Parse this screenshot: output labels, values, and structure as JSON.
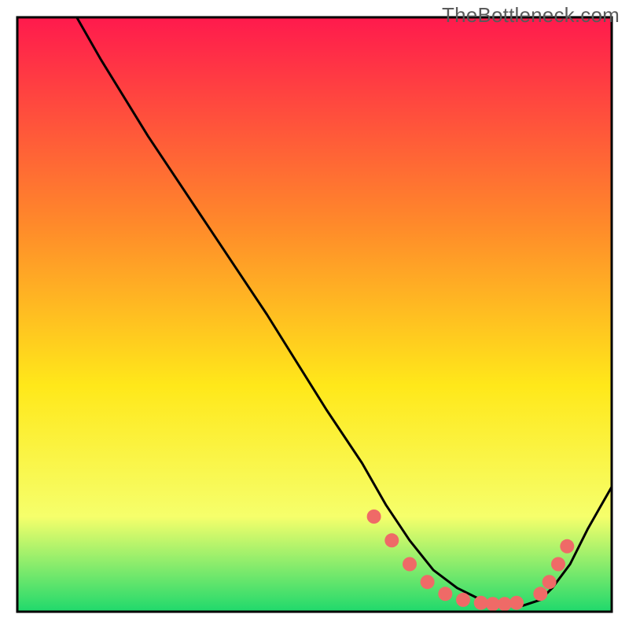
{
  "watermark": "TheBottleneck.com",
  "colors": {
    "gradient_top": "#ff1a4d",
    "gradient_mid1": "#ff8a2a",
    "gradient_mid2": "#ffe81a",
    "gradient_mid3": "#f6ff6b",
    "gradient_bottom": "#1fd96c",
    "curve": "#000000",
    "dots": "#ef6a67",
    "border": "#000000"
  },
  "chart_data": {
    "type": "line",
    "title": "",
    "xlabel": "",
    "ylabel": "",
    "xlim": [
      0,
      100
    ],
    "ylim": [
      0,
      100
    ],
    "series": [
      {
        "name": "curve",
        "x": [
          10,
          14,
          22,
          32,
          42,
          52,
          58,
          62,
          66,
          70,
          74,
          78,
          82,
          85,
          88,
          90,
          93,
          96,
          100
        ],
        "y": [
          100,
          93,
          80,
          65,
          50,
          34,
          25,
          18,
          12,
          7,
          4,
          2,
          1,
          1,
          2,
          4,
          8,
          14,
          21
        ]
      },
      {
        "name": "dots",
        "x": [
          60,
          63,
          66,
          69,
          72,
          75,
          78,
          80,
          82,
          84,
          88,
          89.5,
          91,
          92.5
        ],
        "y": [
          16,
          12,
          8,
          5,
          3,
          2,
          1.5,
          1.3,
          1.3,
          1.5,
          3,
          5,
          8,
          11
        ]
      }
    ]
  }
}
